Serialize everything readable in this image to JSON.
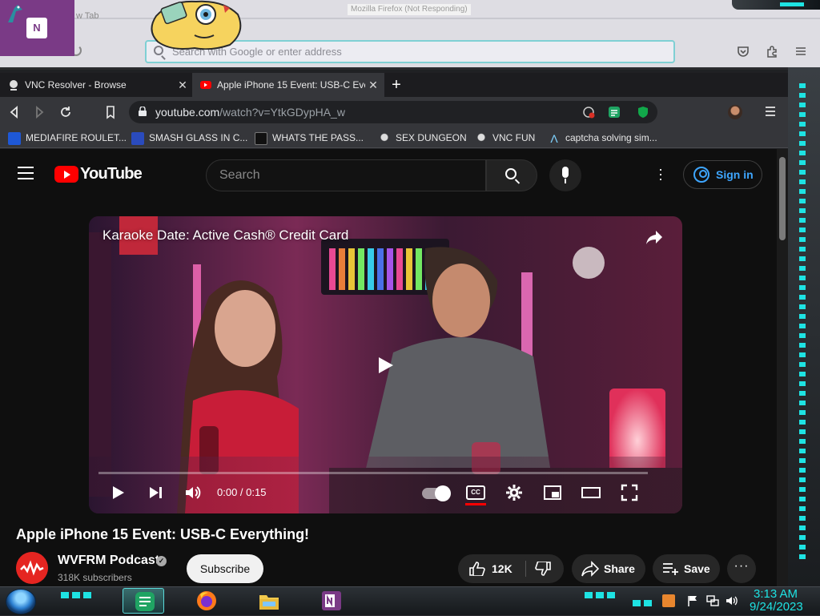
{
  "background_window": {
    "title": "Mozilla Firefox (Not Responding)",
    "tab_fragment": "w Tab",
    "address_placeholder": "Search with Google or enter address"
  },
  "onenote_tile": {
    "logo_text": "N"
  },
  "chrome": {
    "tabs": [
      {
        "label": "VNC Resolver - Browse",
        "active": false
      },
      {
        "label": "Apple iPhone 15 Event: USB-C Eve",
        "active": true
      }
    ],
    "new_tab_symbol": "+",
    "url": {
      "host": "youtube.com",
      "path": "/watch?v=YtkGDypHA_w"
    },
    "bookmarks": [
      {
        "label": "MEDIAFIRE ROULET...",
        "icon": "mediafire-icon"
      },
      {
        "label": "SMASH GLASS IN C...",
        "icon": "bookmark-icon"
      },
      {
        "label": "WHATS THE PASS...",
        "icon": "bookmark-icon"
      },
      {
        "label": "SEX DUNGEON",
        "icon": "vnc-icon"
      },
      {
        "label": "VNC FUN",
        "icon": "vnc-icon"
      },
      {
        "label": "captcha solving sim...",
        "icon": "lambda-icon"
      }
    ]
  },
  "youtube": {
    "logo_text": "YouTube",
    "search_placeholder": "Search",
    "sign_in_label": "Sign in",
    "player": {
      "ad_title": "Karaoke Date: Active Cash® Credit Card",
      "time": "0:00 / 0:15",
      "progress_fraction": 0.0,
      "cc_label": "CC"
    },
    "video_title": "Apple iPhone 15 Event: USB-C Everything!",
    "channel": {
      "name": "WVFRM Podcast",
      "subscribers": "318K subscribers"
    },
    "subscribe_label": "Subscribe",
    "actions": {
      "likes": "12K",
      "share": "Share",
      "save": "Save"
    }
  },
  "taskbar": {
    "apps": [
      "notes-app",
      "firefox",
      "file-explorer",
      "onenote"
    ],
    "clock_time": "3:13 AM",
    "clock_date": "9/24/2023"
  },
  "colors": {
    "youtube_red": "#ff0000",
    "link_blue": "#3ea6ff",
    "accent_cyan": "#1ee3e3",
    "onenote_purple": "#7a3a86"
  }
}
